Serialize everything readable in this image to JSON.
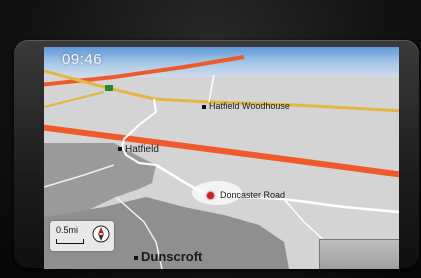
{
  "status": {
    "time": "09:46"
  },
  "map": {
    "places": {
      "hatfield_woodhouse": "Hatfield Woodhouse",
      "hatfield": "Hatfield",
      "doncaster_road": "Doncaster Road",
      "dunscroft": "Dunscroft"
    },
    "scale": {
      "label": "0.5mi"
    },
    "icons": [
      "compass-icon",
      "destination-marker-icon"
    ],
    "colors": {
      "motorway": "#ef5a2a",
      "a_road": "#e3b640",
      "minor_road": "#ffffff",
      "land": "#d4d4d4",
      "urban": "#9a9a9a"
    }
  }
}
